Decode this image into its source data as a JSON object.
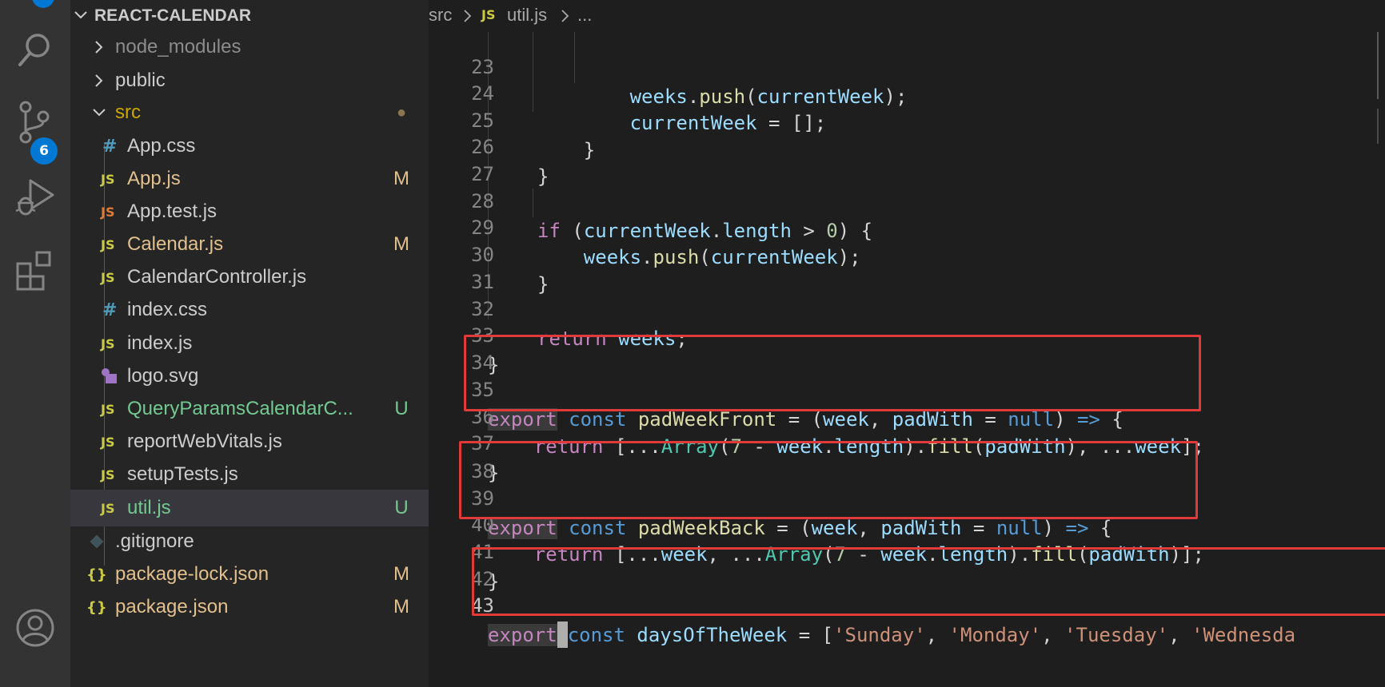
{
  "activity_bar": {
    "icons": [
      "explorer-icon",
      "search-icon",
      "source-control-icon",
      "run-debug-icon",
      "extensions-icon",
      "account-icon"
    ],
    "source_control_badge": "6"
  },
  "sidebar": {
    "root_label": "REACT-CALENDAR",
    "items": [
      {
        "name": "node_modules",
        "type": "folder",
        "expanded": false,
        "git": ""
      },
      {
        "name": "public",
        "type": "folder",
        "expanded": false,
        "git": ""
      },
      {
        "name": "src",
        "type": "folder",
        "expanded": true,
        "git": "●"
      },
      {
        "name": "App.css",
        "type": "css",
        "icon": "#",
        "git": ""
      },
      {
        "name": "App.js",
        "type": "js",
        "icon": "JS",
        "git": "M"
      },
      {
        "name": "App.test.js",
        "type": "js-test",
        "icon": "JS",
        "git": ""
      },
      {
        "name": "Calendar.js",
        "type": "js",
        "icon": "JS",
        "git": "M"
      },
      {
        "name": "CalendarController.js",
        "type": "js",
        "icon": "JS",
        "git": ""
      },
      {
        "name": "index.css",
        "type": "css",
        "icon": "#",
        "git": ""
      },
      {
        "name": "index.js",
        "type": "js",
        "icon": "JS",
        "git": ""
      },
      {
        "name": "logo.svg",
        "type": "svg",
        "icon": "svg",
        "git": ""
      },
      {
        "name": "QueryParamsCalendarC...",
        "type": "js",
        "icon": "JS",
        "git": "U"
      },
      {
        "name": "reportWebVitals.js",
        "type": "js",
        "icon": "JS",
        "git": ""
      },
      {
        "name": "setupTests.js",
        "type": "js",
        "icon": "JS",
        "git": ""
      },
      {
        "name": "util.js",
        "type": "js",
        "icon": "JS",
        "git": "U"
      },
      {
        "name": ".gitignore",
        "type": "git",
        "icon": "git",
        "git": ""
      },
      {
        "name": "package-lock.json",
        "type": "json",
        "icon": "{}",
        "git": "M"
      },
      {
        "name": "package.json",
        "type": "json",
        "icon": "{}",
        "git": "M"
      }
    ],
    "selected": "util.js"
  },
  "breadcrumb": {
    "folder": "src",
    "file_icon": "JS",
    "file": "util.js",
    "more": "..."
  },
  "editor": {
    "lines": [
      {
        "num": "23",
        "text": "            weeks.push(currentWeek);"
      },
      {
        "num": "24",
        "text": "            currentWeek = [];"
      },
      {
        "num": "25",
        "text": "        }"
      },
      {
        "num": "26",
        "text": "    }"
      },
      {
        "num": "27",
        "text": ""
      },
      {
        "num": "28",
        "text": "    if (currentWeek.length > 0) {"
      },
      {
        "num": "29",
        "text": "        weeks.push(currentWeek);"
      },
      {
        "num": "30",
        "text": "    }"
      },
      {
        "num": "31",
        "text": ""
      },
      {
        "num": "32",
        "text": "    return weeks;"
      },
      {
        "num": "33",
        "text": "}"
      },
      {
        "num": "34",
        "text": ""
      },
      {
        "num": "35",
        "text": "export const padWeekFront = (week, padWith = null) => {"
      },
      {
        "num": "36",
        "text": "    return [...Array(7 - week.length).fill(padWith), ...week];"
      },
      {
        "num": "37",
        "text": "}"
      },
      {
        "num": "38",
        "text": ""
      },
      {
        "num": "39",
        "text": "export const padWeekBack = (week, padWith = null) => {"
      },
      {
        "num": "40",
        "text": "    return [...week, ...Array(7 - week.length).fill(padWith)];"
      },
      {
        "num": "41",
        "text": "}"
      },
      {
        "num": "42",
        "text": ""
      },
      {
        "num": "43",
        "text": "export const daysOfTheWeek = ['Sunday', 'Monday', 'Tuesday', 'Wednesda"
      }
    ],
    "highlight_color": "#e03a3a"
  }
}
